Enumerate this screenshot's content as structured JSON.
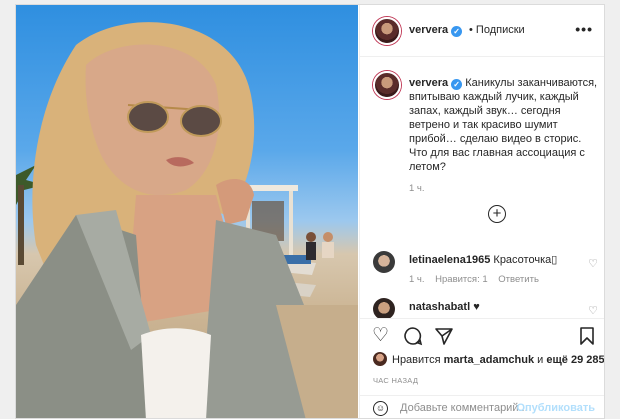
{
  "post": {
    "author": "ververa",
    "header_follow": "• Подписки",
    "more": "•••",
    "caption_text": "Каникулы заканчиваются, впитываю каждый лучик, каждый запах, каждый звук… сегодня ветрено и так красиво шумит прибой… сделаю видео в сторис. Что для вас главная ассоциация с летом?",
    "caption_time": "1 ч."
  },
  "comments": [
    {
      "user": "letinaelena1965",
      "text": "Красоточка",
      "time": "1 ч.",
      "likes": "Нравится: 1",
      "reply": "Ответить"
    },
    {
      "user": "natashabatl",
      "text": "♥"
    }
  ],
  "likes": {
    "prefix": "Нравится",
    "user": "marta_adamchuk",
    "joiner": "и",
    "count": "ещё 29 285"
  },
  "posted_ago": "ЧАС НАЗАД",
  "comment_box": {
    "placeholder": "Добавьте комментарий...",
    "publish": "Опубликовать"
  },
  "icons": [
    "more-icon",
    "verified-icon",
    "plus-circle-icon",
    "heart-icon",
    "comment-icon",
    "share-icon",
    "bookmark-icon",
    "emoji-icon"
  ],
  "colors": {
    "verified": "#3897f0",
    "publish_disabled": "#b2dffc",
    "muted": "#8e8e8e"
  }
}
